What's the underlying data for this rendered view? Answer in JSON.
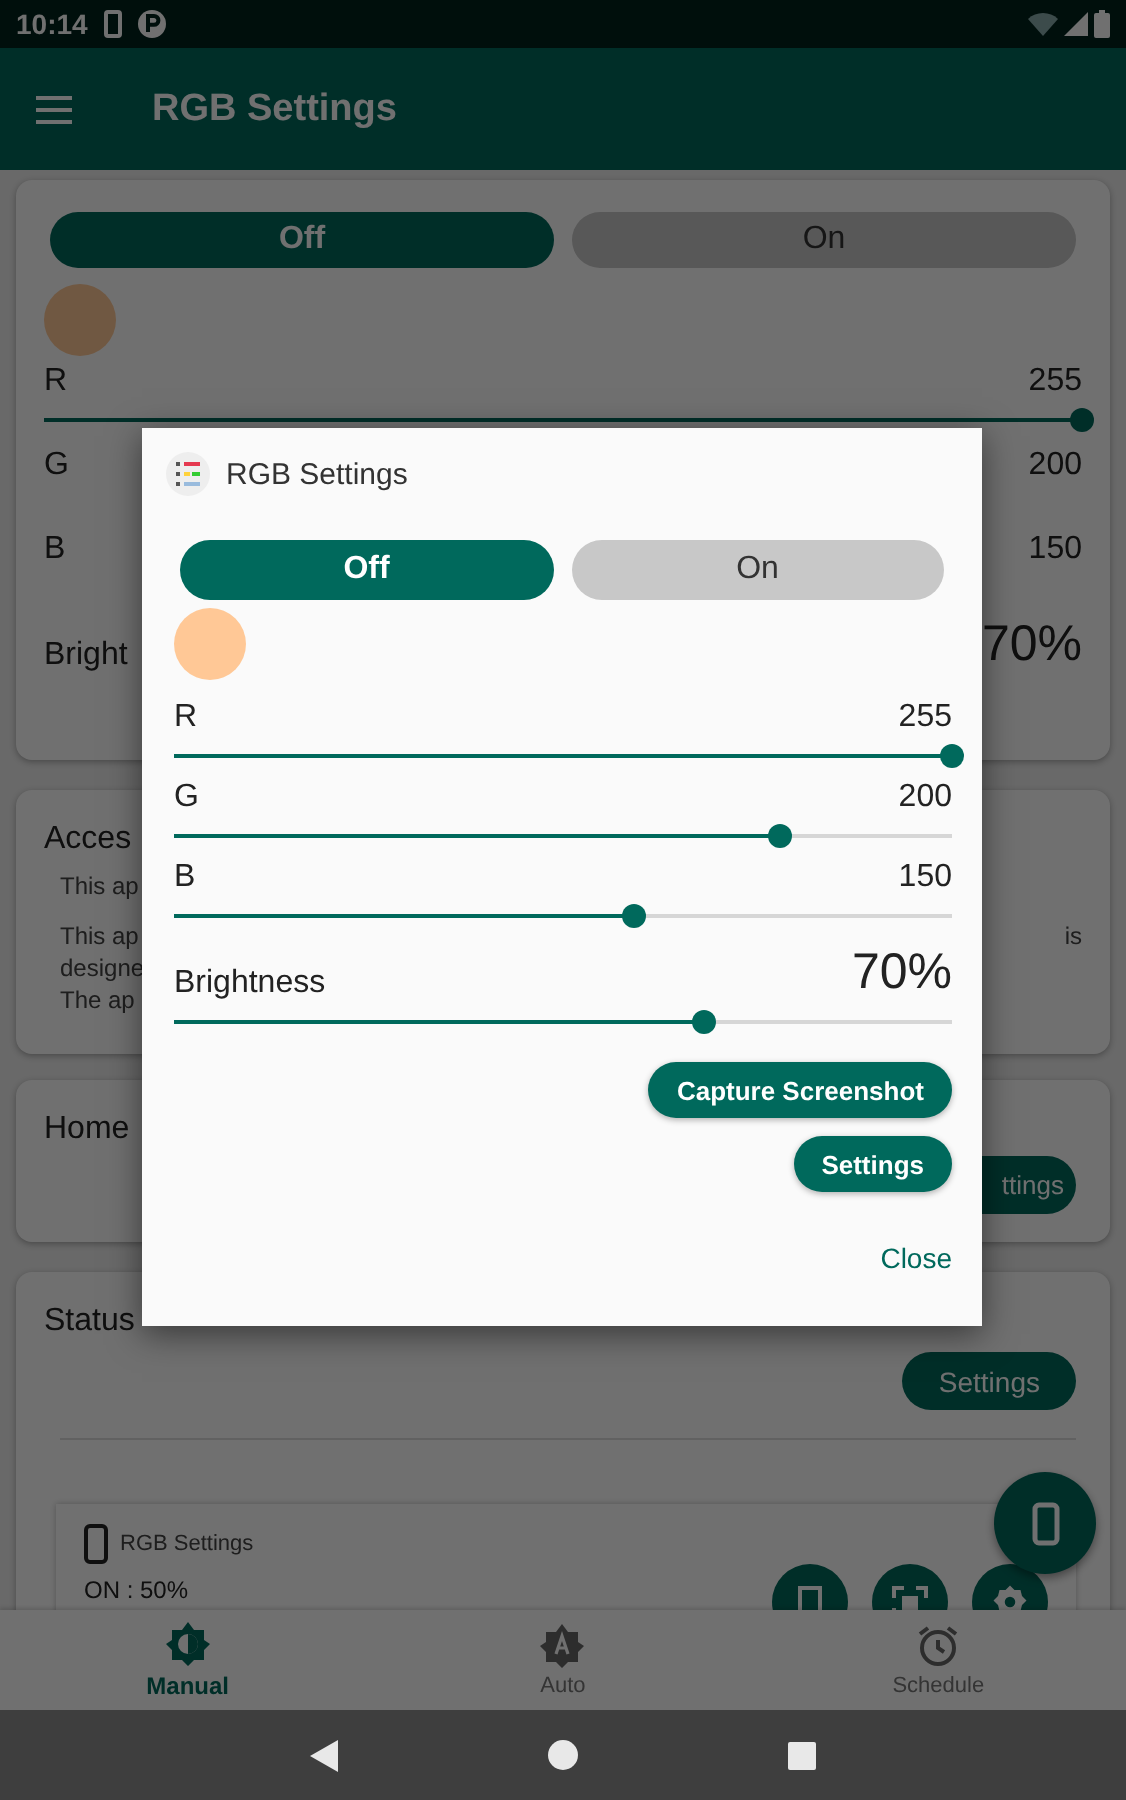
{
  "status_bar": {
    "time": "10:14"
  },
  "app_bar": {
    "title": "RGB Settings"
  },
  "main_card": {
    "toggle": [
      {
        "label": "Off",
        "selected": true
      },
      {
        "label": "On",
        "selected": false
      }
    ],
    "rows": [
      {
        "label": "R",
        "value": "255",
        "level": 1
      },
      {
        "label": "G",
        "value": "200"
      },
      {
        "label": "B",
        "value": "150"
      },
      {
        "label": "Bright",
        "value": "70%"
      }
    ]
  },
  "access_card": {
    "title": "Acces",
    "lines": [
      {
        "left": "This ap"
      },
      {
        "left": "This ap",
        "right": "is"
      },
      {
        "left": "designe"
      },
      {
        "left": "The ap"
      }
    ]
  },
  "home_card": {
    "title": "Home",
    "button": "ttings"
  },
  "status_card": {
    "title": "Status",
    "button": "Settings",
    "widget": {
      "title": "RGB Settings",
      "status": "ON : 50%"
    }
  },
  "bottom_nav": [
    {
      "label": "Manual",
      "selected": true
    },
    {
      "label": "Auto",
      "selected": false
    },
    {
      "label": "Schedule",
      "selected": false
    }
  ],
  "dialog": {
    "title": "RGB Settings",
    "toggle": [
      {
        "label": "Off",
        "selected": true
      },
      {
        "label": "On",
        "selected": false
      }
    ],
    "rows": [
      {
        "label": "R",
        "value": "255",
        "level": 1
      },
      {
        "label": "G",
        "value": "200",
        "level": 0.78
      },
      {
        "label": "B",
        "value": "150",
        "level": 0.59
      },
      {
        "label": "Brightness",
        "value": "70%",
        "level": 0.68
      }
    ],
    "buttons": [
      "Capture Screenshot",
      "Settings"
    ],
    "close": "Close"
  }
}
